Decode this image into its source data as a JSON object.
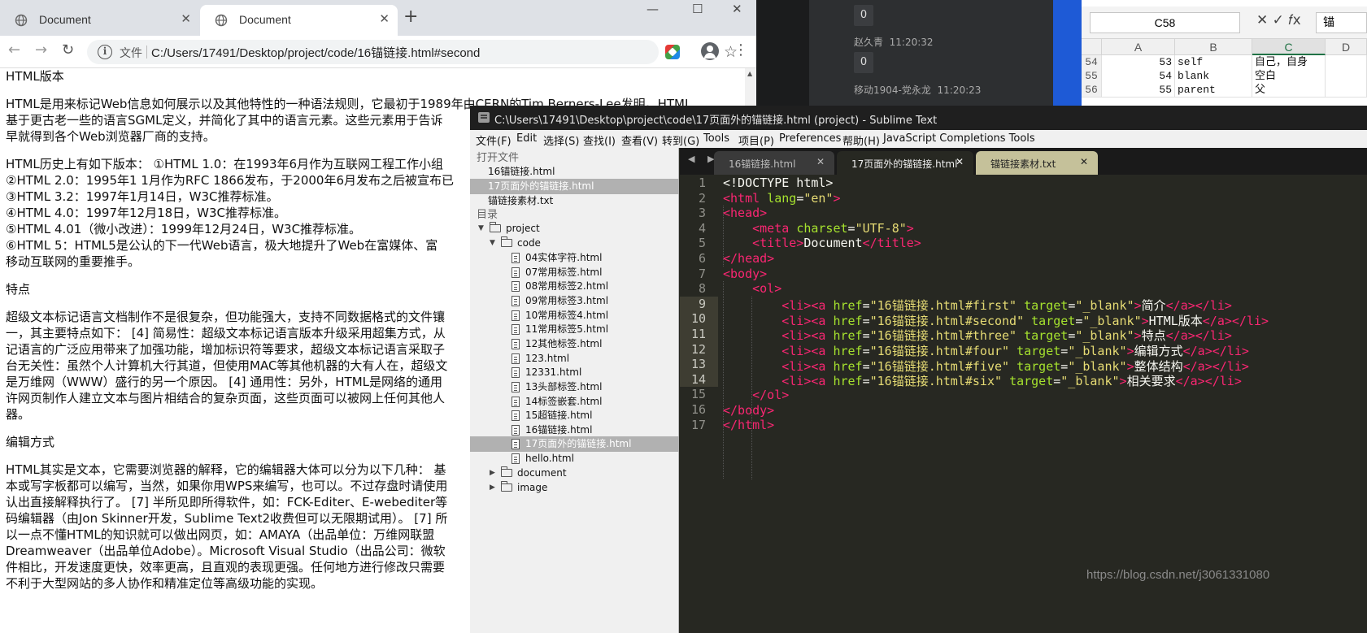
{
  "chrome": {
    "tabs": [
      {
        "title": "Document",
        "close": "✕",
        "active": false
      },
      {
        "title": "Document",
        "close": "✕",
        "active": true
      }
    ],
    "new_tab": "+",
    "window_buttons": {
      "minimize": "—",
      "maximize": "☐",
      "close": "✕"
    },
    "nav": {
      "back": "←",
      "forward": "→",
      "reload": "↻"
    },
    "omnibox": {
      "info_glyph": "i",
      "file_label": "文件",
      "url": "C:/Users/17491/Desktop/project/code/16锚链接.html#second",
      "star": "☆"
    },
    "menu": "⋮",
    "content": [
      "HTML版本",
      "",
      "HTML是用来标记Web信息如何展示以及其他特性的一种语法规则，它最初于1989年由CERN的Tim Berners-Lee发明。HTML",
      "基于更古老一些的语言SGML定义，并简化了其中的语言元素。这些元素用于告诉",
      "早就得到各个Web浏览器厂商的支持。",
      "",
      "HTML历史上有如下版本：  ①HTML 1.0：在1993年6月作为互联网工程工作小组",
      "②HTML 2.0：1995年1 1月作为RFC 1866发布，于2000年6月发布之后被宣布已",
      "③HTML 3.2：1997年1月14日，W3C推荐标准。",
      "④HTML 4.0：1997年12月18日，W3C推荐标准。",
      "⑤HTML 4.01（微小改进）：1999年12月24日，W3C推荐标准。",
      "⑥HTML 5：HTML5是公认的下一代Web语言，极大地提升了Web在富媒体、富",
      "移动互联网的重要推手。",
      "",
      "特点",
      "",
      "超级文本标记语言文档制作不是很复杂，但功能强大，支持不同数据格式的文件镶",
      "一，其主要特点如下：  [4] 简易性：超级文本标记语言版本升级采用超集方式，从",
      "记语言的广泛应用带来了加强功能，增加标识符等要求，超级文本标记语言采取子",
      "台无关性：虽然个人计算机大行其道，但使用MAC等其他机器的大有人在，超级文",
      "是万维网（WWW）盛行的另一个原因。 [4] 通用性：另外，HTML是网络的通用",
      "许网页制作人建立文本与图片相结合的复杂页面，这些页面可以被网上任何其他人",
      "器。",
      "",
      "编辑方式",
      "",
      "HTML其实是文本，它需要浏览器的解释，它的编辑器大体可以分为以下几种：  基",
      "本或写字板都可以编写，当然，如果你用WPS来编写，也可以。不过存盘时请使用",
      "认出直接解释执行了。 [7] 半所见即所得软件，如：FCK-Editer、E-webediter等",
      "码编辑器（由Jon Skinner开发，Sublime Text2收费但可以无限期试用）。 [7] 所",
      "以一点不懂HTML的知识就可以做出网页，如：AMAYA（出品单位：万维网联盟",
      "Dreamweaver（出品单位Adobe）。Microsoft Visual Studio（出品公司：微软",
      "件相比，开发速度更快，效率更高，且直观的表现更强。任何地方进行修改只需要",
      "不利于大型网站的多人协作和精准定位等高级功能的实现。"
    ]
  },
  "chat": {
    "messages": [
      {
        "value": "0"
      },
      {
        "sender": "赵久青",
        "time": "11:20:32"
      },
      {
        "value": "0"
      },
      {
        "sender": "移动1904-党永龙",
        "time": "11:20:23"
      }
    ]
  },
  "excel": {
    "name_box": "C58",
    "formula_icons": "✕  ✓  𝑓x",
    "formula_value": "锚",
    "columns": [
      "A",
      "B",
      "C",
      "D"
    ],
    "rows": [
      {
        "num": "54",
        "a": "53",
        "b": "self",
        "c": "自己，自身"
      },
      {
        "num": "55",
        "a": "54",
        "b": "blank",
        "c": "空白"
      },
      {
        "num": "56",
        "a": "55",
        "b": "parent",
        "c": "父"
      }
    ]
  },
  "sublime": {
    "title": "C:\\Users\\17491\\Desktop\\project\\code\\17页面外的锚链接.html (project) - Sublime Text",
    "menu": [
      "文件(F)",
      "Edit",
      "选择(S)",
      "查找(I)",
      "查看(V)",
      "转到(G)",
      "Tools",
      "项目(P)",
      "Preferences",
      "帮助(H)",
      "JavaScript Completions Tools"
    ],
    "sidebar": {
      "open_files_header": "打开文件",
      "open_files": [
        "16锚链接.html",
        "17页面外的锚链接.html",
        "锚链接素材.txt"
      ],
      "folders_header": "目录",
      "project": "project",
      "code": "code",
      "code_files": [
        "04实体字符.html",
        "07常用标签.html",
        "08常用标签2.html",
        "09常用标签3.html",
        "10常用标签4.html",
        "11常用标签5.html",
        "12其他标签.html",
        "123.html",
        "12331.html",
        "13头部标签.html",
        "14标签嵌套.html",
        "15超链接.html",
        "16锚链接.html",
        "17页面外的锚链接.html",
        "hello.html"
      ],
      "document": "document",
      "image": "image"
    },
    "tab_arrows": "◀ ▶",
    "tabs": [
      {
        "label": "16锚链接.html",
        "close": "✕"
      },
      {
        "label": "17页面外的锚链接.html",
        "close": "✕"
      },
      {
        "label": "锚链接素材.txt",
        "close": "✕"
      }
    ],
    "line_numbers": [
      "1",
      "2",
      "3",
      "4",
      "5",
      "6",
      "7",
      "8",
      "9",
      "10",
      "11",
      "12",
      "13",
      "14",
      "15",
      "16",
      "17"
    ]
  },
  "watermark": "https://blog.csdn.net/j3061331080"
}
